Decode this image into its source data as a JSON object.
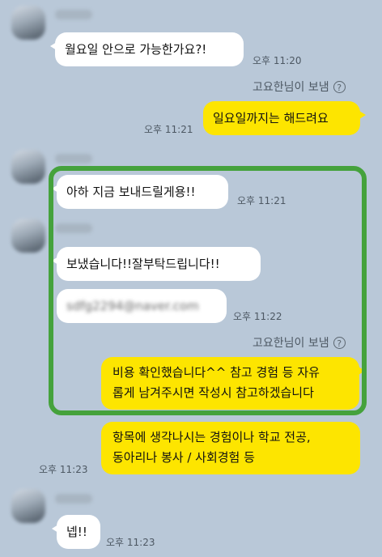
{
  "chat": {
    "msg1": {
      "text": "월요일 안으로 가능한가요?!",
      "time": "오후 11:20"
    },
    "sent_note_1": "고요한님이 보냄",
    "msg2": {
      "text": "일요일까지는 해드려요",
      "time": "오후 11:21"
    },
    "msg3": {
      "text": "아하 지금 보내드릴게용!!",
      "time": "오후 11:21"
    },
    "msg4": {
      "text": "보냈습니다!!잘부탁드립니다!!"
    },
    "msg5": {
      "text": "sdfg2294@naver.com",
      "time": "오후 11:22"
    },
    "sent_note_2": "고요한님이 보냄",
    "msg6": {
      "line1": "비용 확인했습니다^^ 참고 경험 등 자유",
      "line2": "롭게 남겨주시면 작성시 참고하겠습니다"
    },
    "msg7": {
      "line1": "항목에 생각나시는 경험이나 학교 전공,",
      "line2": "동아리나 봉사 / 사회경험 등",
      "time": "오후 11:23"
    },
    "msg8": {
      "text": "넵!!",
      "time": "오후 11:23"
    }
  },
  "colors": {
    "background": "#b9c8d8",
    "my_bubble": "#fde500",
    "their_bubble": "#ffffff",
    "highlight": "#45a23c"
  },
  "icons": {
    "help": "question-circle-icon"
  }
}
